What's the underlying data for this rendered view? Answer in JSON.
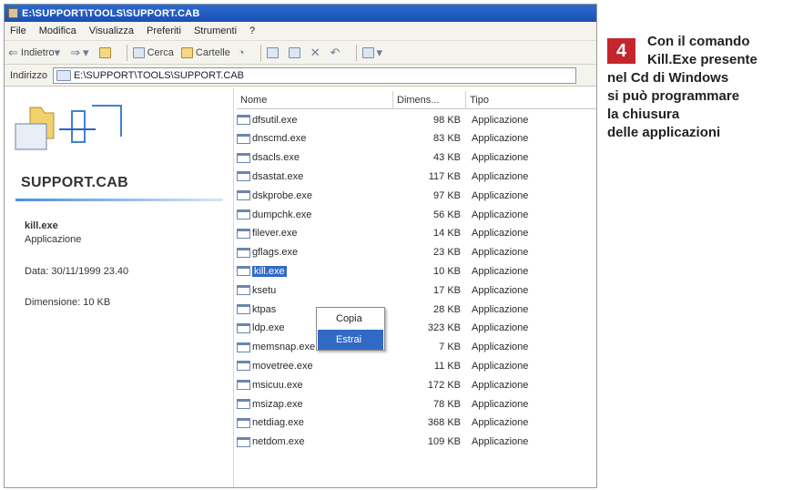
{
  "window": {
    "title": "E:\\SUPPORT\\TOOLS\\SUPPORT.CAB"
  },
  "menu": [
    "File",
    "Modifica",
    "Visualizza",
    "Preferiti",
    "Strumenti",
    "?"
  ],
  "toolbar": {
    "back": "Indietro",
    "search": "Cerca",
    "folders": "Cartelle"
  },
  "address": {
    "label": "Indirizzo",
    "value": "E:\\SUPPORT\\TOOLS\\SUPPORT.CAB"
  },
  "leftpane": {
    "title": "SUPPORT.CAB",
    "selected_name": "kill.exe",
    "selected_type": "Applicazione",
    "date": "Data: 30/11/1999 23.40",
    "size": "Dimensione: 10 KB"
  },
  "columns": {
    "name": "Nome",
    "size": "Dimens...",
    "type": "Tipo"
  },
  "files": [
    {
      "name": "dfsutil.exe",
      "size": "98 KB",
      "type": "Applicazione"
    },
    {
      "name": "dnscmd.exe",
      "size": "83 KB",
      "type": "Applicazione"
    },
    {
      "name": "dsacls.exe",
      "size": "43 KB",
      "type": "Applicazione"
    },
    {
      "name": "dsastat.exe",
      "size": "117 KB",
      "type": "Applicazione"
    },
    {
      "name": "dskprobe.exe",
      "size": "97 KB",
      "type": "Applicazione"
    },
    {
      "name": "dumpchk.exe",
      "size": "56 KB",
      "type": "Applicazione"
    },
    {
      "name": "filever.exe",
      "size": "14 KB",
      "type": "Applicazione"
    },
    {
      "name": "gflags.exe",
      "size": "23 KB",
      "type": "Applicazione"
    },
    {
      "name": "kill.exe",
      "size": "10 KB",
      "type": "Applicazione"
    },
    {
      "name": "ksetu",
      "size": "17 KB",
      "type": "Applicazione"
    },
    {
      "name": "ktpas",
      "size": "28 KB",
      "type": "Applicazione"
    },
    {
      "name": "ldp.exe",
      "size": "323 KB",
      "type": "Applicazione"
    },
    {
      "name": "memsnap.exe",
      "size": "7 KB",
      "type": "Applicazione"
    },
    {
      "name": "movetree.exe",
      "size": "11 KB",
      "type": "Applicazione"
    },
    {
      "name": "msicuu.exe",
      "size": "172 KB",
      "type": "Applicazione"
    },
    {
      "name": "msizap.exe",
      "size": "78 KB",
      "type": "Applicazione"
    },
    {
      "name": "netdiag.exe",
      "size": "368 KB",
      "type": "Applicazione"
    },
    {
      "name": "netdom.exe",
      "size": "109 KB",
      "type": "Applicazione"
    }
  ],
  "context_menu": [
    "Copia",
    "Estrai"
  ],
  "caption": {
    "number": "4",
    "lines": [
      "Con il comando",
      "Kill.Exe presente",
      "nel Cd di Windows",
      "si può programmare",
      "la chiusura",
      "delle applicazioni"
    ]
  },
  "colors": {
    "titlebar": "#1c4fb4",
    "selection": "#316ac5",
    "badge": "#c3262d"
  }
}
